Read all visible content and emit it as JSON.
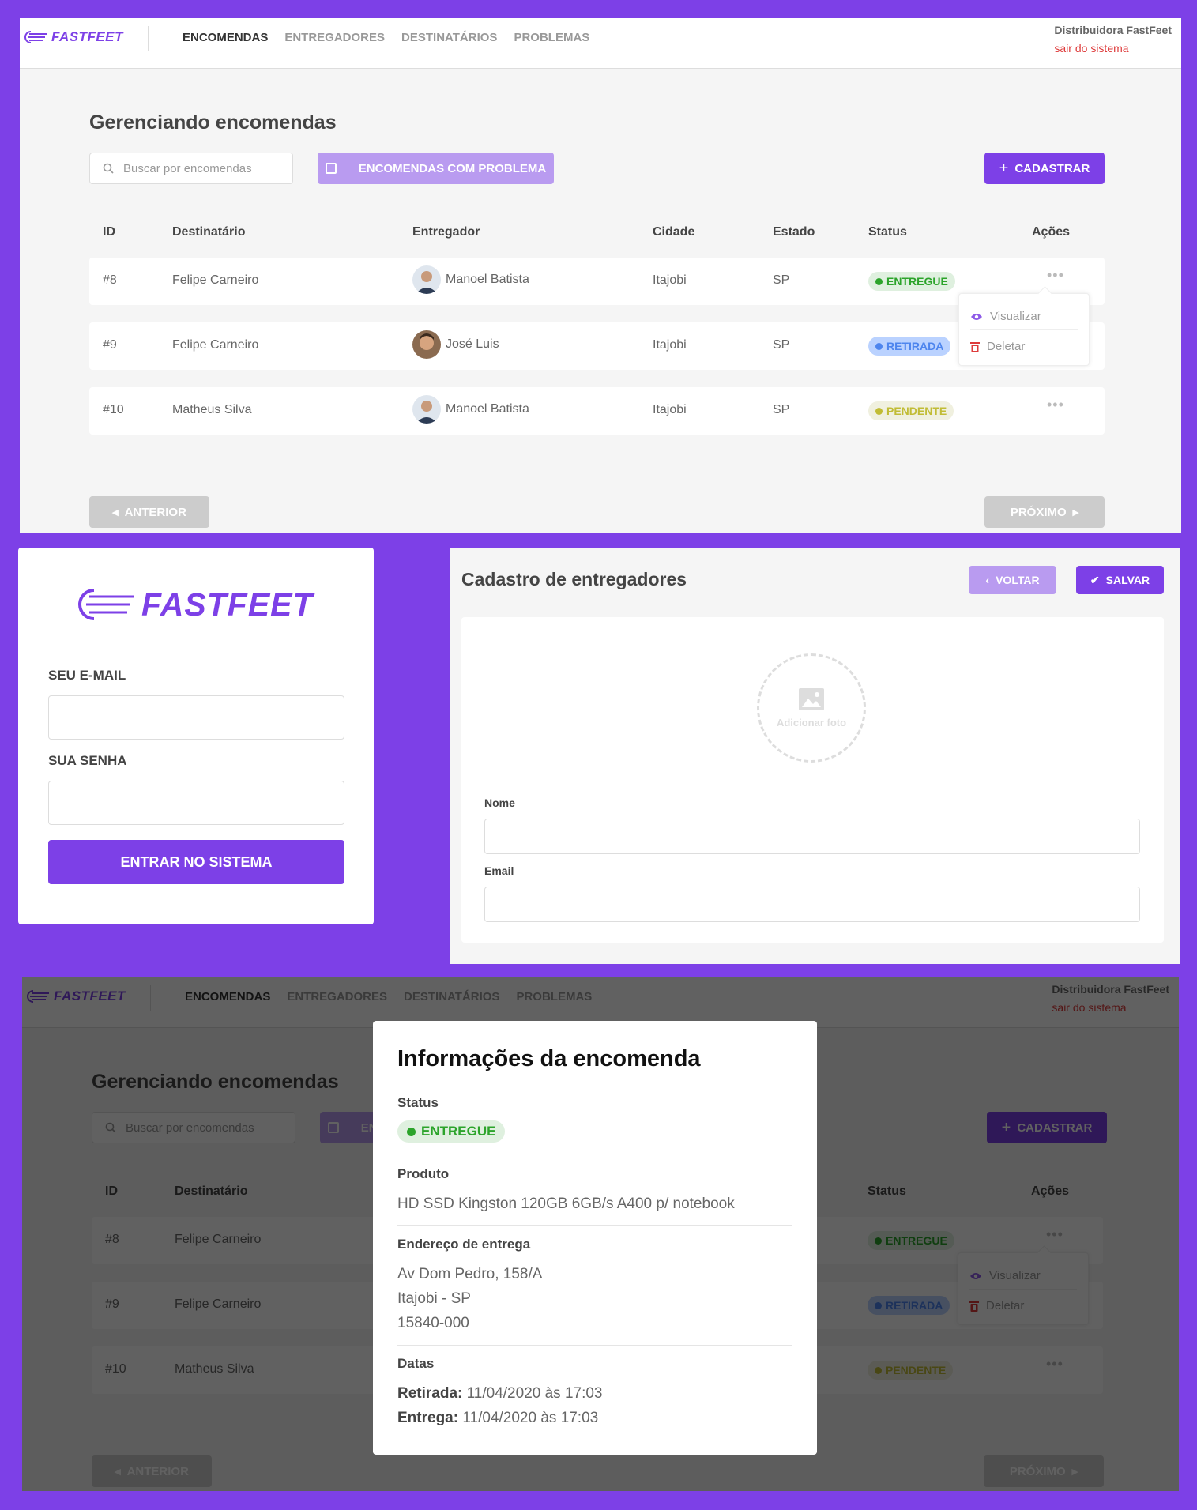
{
  "header": {
    "logo": "FASTFEET",
    "nav": [
      "ENCOMENDAS",
      "ENTREGADORES",
      "DESTINATÁRIOS",
      "PROBLEMAS"
    ],
    "user_name": "Distribuidora FastFeet",
    "logout": "sair do sistema"
  },
  "orders_page": {
    "title": "Gerenciando encomendas",
    "search_placeholder": "Buscar por encomendas",
    "problem_button": "ENCOMENDAS COM PROBLEMA",
    "new_button": "CADASTRAR",
    "columns": [
      "ID",
      "Destinatário",
      "Entregador",
      "Cidade",
      "Estado",
      "Status",
      "Ações"
    ],
    "rows": [
      {
        "id": "#8",
        "recipient": "Felipe Carneiro",
        "deliveryman": "Manoel Batista",
        "city": "Itajobi",
        "state": "SP",
        "status": "ENTREGUE"
      },
      {
        "id": "#9",
        "recipient": "Felipe Carneiro",
        "deliveryman": "José Luis",
        "city": "Itajobi",
        "state": "SP",
        "status": "RETIRADA"
      },
      {
        "id": "#10",
        "recipient": "Matheus Silva",
        "deliveryman": "Manoel Batista",
        "city": "Itajobi",
        "state": "SP",
        "status": "PENDENTE"
      }
    ],
    "actions_menu": {
      "view": "Visualizar",
      "delete": "Deletar"
    },
    "actions_dots": "•••",
    "prev": "ANTERIOR",
    "next": "PRÓXIMO"
  },
  "login": {
    "logo": "FASTFEET",
    "email_label": "SEU E-MAIL",
    "password_label": "SUA SENHA",
    "submit": "ENTRAR NO SISTEMA"
  },
  "deliveryman_form": {
    "title": "Cadastro de entregadores",
    "back": "VOLTAR",
    "save": "SALVAR",
    "photo_label": "Adicionar foto",
    "name_label": "Nome",
    "email_label": "Email"
  },
  "order_modal": {
    "title": "Informações da encomenda",
    "status_label": "Status",
    "status": "ENTREGUE",
    "product_label": "Produto",
    "product": "HD SSD Kingston 120GB 6GB/s A400 p/ notebook",
    "address_label": "Endereço de entrega",
    "address_line1": "Av Dom Pedro, 158/A",
    "address_line2": "Itajobi - SP",
    "address_line3": "15840-000",
    "dates_label": "Datas",
    "pickup_label": "Retirada:",
    "pickup": "11/04/2020 às 17:03",
    "delivery_label": "Entrega:",
    "delivery": "11/04/2020 às 17:03"
  },
  "colors": {
    "accent": "#7d40e7",
    "delivered": "#2ca42b",
    "picked_up": "#4d85ee",
    "pending": "#c1bc35",
    "danger": "#de3b3b"
  }
}
